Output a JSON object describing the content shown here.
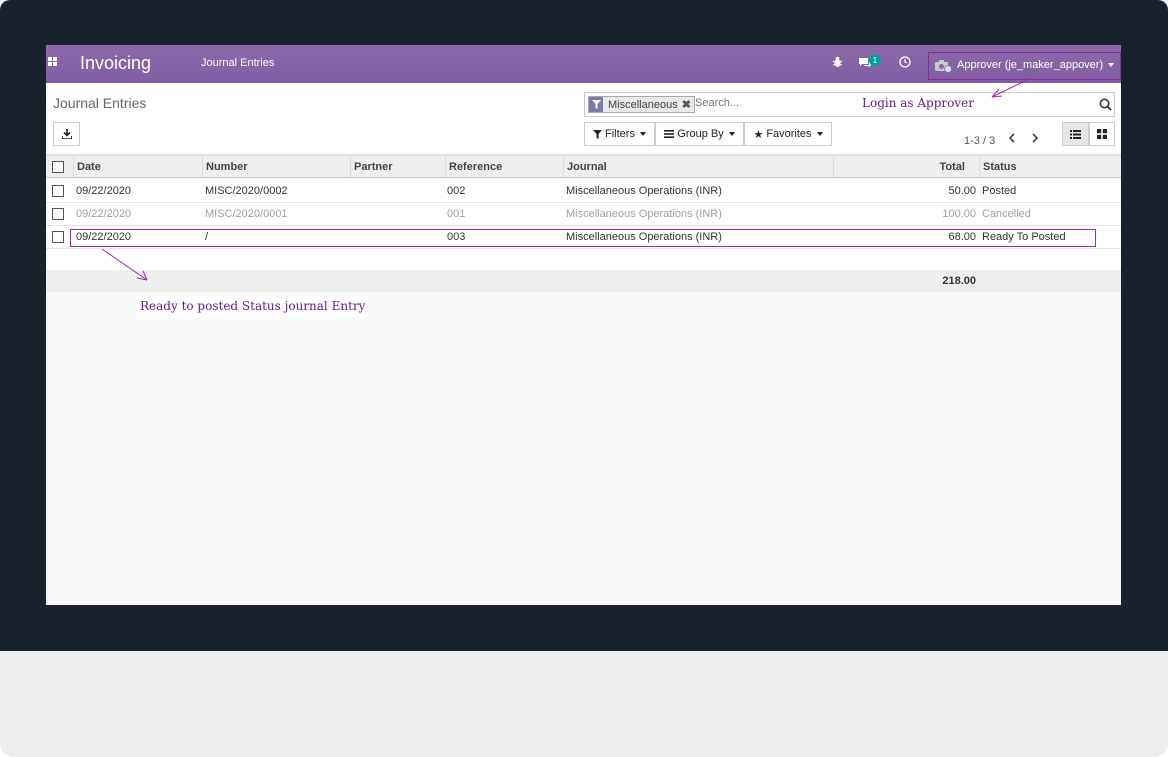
{
  "navbar": {
    "brand": "Invoicing",
    "menu_journal_entries": "Journal Entries",
    "messages_count": "1",
    "user_label": "Approver (je_maker_appover)"
  },
  "control_panel": {
    "breadcrumb": "Journal Entries",
    "search": {
      "facet_label": "Miscellaneous",
      "placeholder": "Search..."
    },
    "filters_label": "Filters",
    "groupby_label": "Group By",
    "favorites_label": "Favorites",
    "pager": "1-3 / 3"
  },
  "table": {
    "headers": {
      "date": "Date",
      "number": "Number",
      "partner": "Partner",
      "reference": "Reference",
      "journal": "Journal",
      "total": "Total",
      "status": "Status"
    },
    "rows": [
      {
        "date": "09/22/2020",
        "number": "MISC/2020/0002",
        "partner": "",
        "reference": "002",
        "journal": "Miscellaneous Operations (INR)",
        "total": "50.00",
        "status": "Posted"
      },
      {
        "date": "09/22/2020",
        "number": "MISC/2020/0001",
        "partner": "",
        "reference": "001",
        "journal": "Miscellaneous Operations (INR)",
        "total": "100.00",
        "status": "Cancelled"
      },
      {
        "date": "09/22/2020",
        "number": "/",
        "partner": "",
        "reference": "003",
        "journal": "Miscellaneous Operations (INR)",
        "total": "68.00",
        "status": "Ready To Posted"
      }
    ],
    "sum_total": "218.00"
  },
  "annotations": {
    "login_note": "Login as Approver",
    "status_note": "Ready to posted Status journal Entry"
  },
  "colors": {
    "navbar": "#8b6aa9",
    "annotation": "#a12ca6",
    "badge": "#00a09d"
  }
}
